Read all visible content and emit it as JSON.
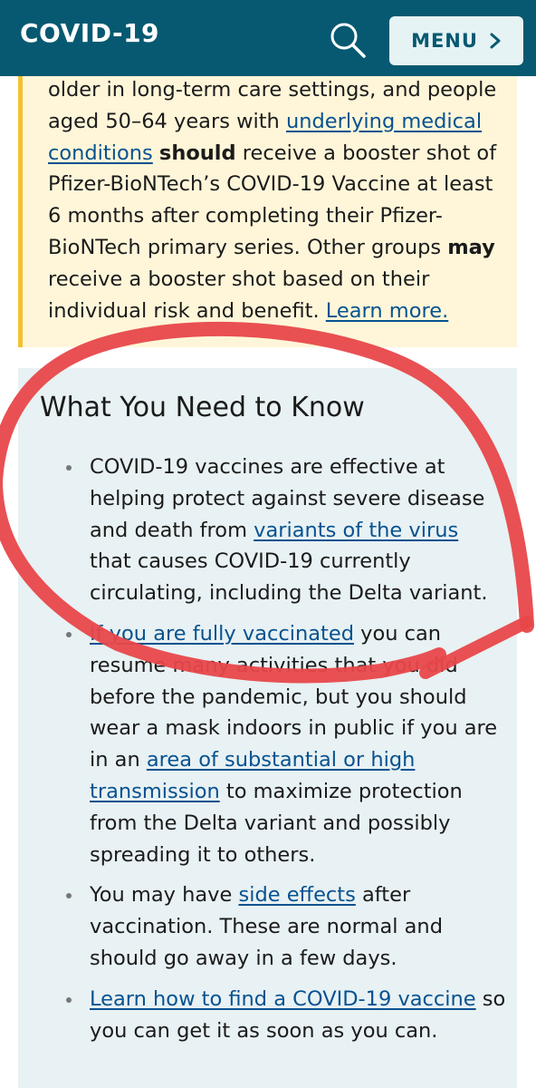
{
  "header": {
    "title": "COVID-19",
    "search_icon": "search-icon",
    "menu_label": "MENU",
    "menu_icon": "chevron-right-icon",
    "background_color": "#065971"
  },
  "booster_callout": {
    "line1": "older in long-term care settings, and people aged 50–64 years with ",
    "link1": "underlying medical conditions",
    "bold1": "should",
    "line2": " receive a booster shot of Pfizer-BioNTech’s COVID-19 Vaccine at least 6 months after completing their Pfizer-BioNTech primary series. Other groups ",
    "bold2": "may",
    "line3": " receive a booster shot based on their individual risk and benefit. ",
    "link2": "Learn more.",
    "background_color": "#fff6d9",
    "border_color": "#f5c131"
  },
  "know_section": {
    "title": "What You Need to Know",
    "background_color": "#e8f1f3",
    "items": [
      {
        "pre": "COVID-19 vaccines are effective at helping protect against severe disease and death from ",
        "link": "variants of the virus",
        "post": " that causes COVID-19 currently circulating, including the Delta variant."
      },
      {
        "link": "If you are fully vaccinated",
        "mid": " you can resume many activities that you did before the pandemic, but you should wear a mask indoors in public if you are in an ",
        "link2": "area of substantial or high transmission",
        "post": " to maximize protection from the Delta variant and possibly spreading it to others."
      },
      {
        "pre": "You may have ",
        "link": "side effects",
        "post": " after vaccination. These are normal and should go away in a few days."
      },
      {
        "link": "Learn how to find a COVID-19 vaccine",
        "post": " so you can get it as soon as you can."
      }
    ]
  },
  "colors": {
    "link": "#075290",
    "annotation_red": "#e8474a"
  }
}
